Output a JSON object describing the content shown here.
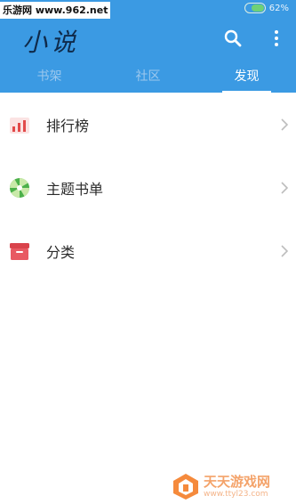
{
  "status_bar": {
    "watermark": "乐游网 www.962.net",
    "battery": "62%"
  },
  "app": {
    "title": "小说"
  },
  "tabs": [
    {
      "label": "书架",
      "active": false
    },
    {
      "label": "社区",
      "active": false
    },
    {
      "label": "发现",
      "active": true
    }
  ],
  "list": [
    {
      "label": "排行榜",
      "icon": "ranking-bar-chart-icon"
    },
    {
      "label": "主题书单",
      "icon": "theme-booklist-icon"
    },
    {
      "label": "分类",
      "icon": "category-box-icon"
    }
  ],
  "watermark_bottom": {
    "name": "天天游戏网",
    "url": "www.ttyl23.com"
  },
  "colors": {
    "header": "#3b9ae3",
    "tab_active": "#ffffff",
    "tab_inactive": "#9cc8ee"
  }
}
